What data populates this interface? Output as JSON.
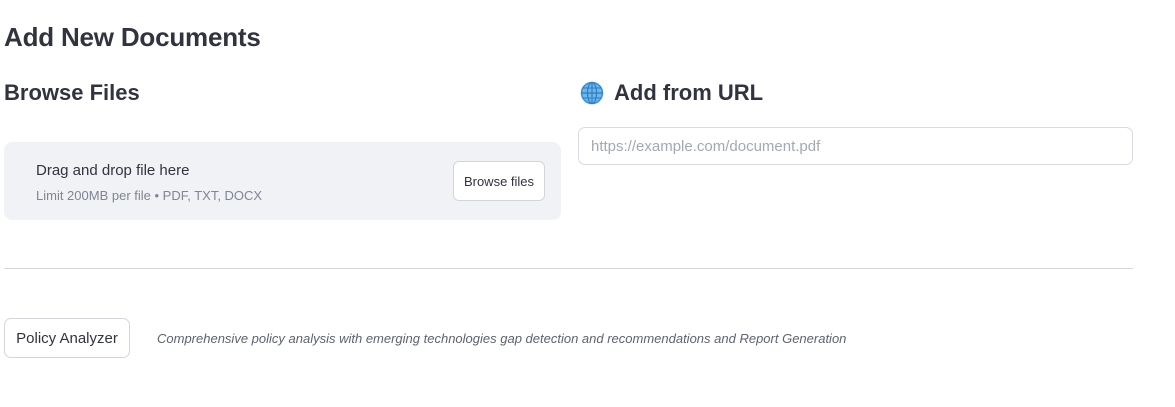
{
  "page": {
    "title": "Add New Documents"
  },
  "browse_section": {
    "heading": "Browse Files",
    "dropzone": {
      "main_text": "Drag and drop file here",
      "limit_text": "Limit 200MB per file • PDF, TXT, DOCX",
      "button_label": "Browse files"
    }
  },
  "url_section": {
    "icon": "globe-icon",
    "heading": "Add from URL",
    "input": {
      "value": "",
      "placeholder": "https://example.com/document.pdf"
    }
  },
  "analyzer": {
    "button_label": "Policy Analyzer",
    "caption": "Comprehensive policy analysis with emerging technologies gap detection and recommendations and Report Generation"
  },
  "colors": {
    "text": "#31333f",
    "dropzone_bg": "#f0f2f6",
    "muted_text": "#808495",
    "border": "#d3d5db",
    "globe_blue": "#3b8fd6"
  }
}
